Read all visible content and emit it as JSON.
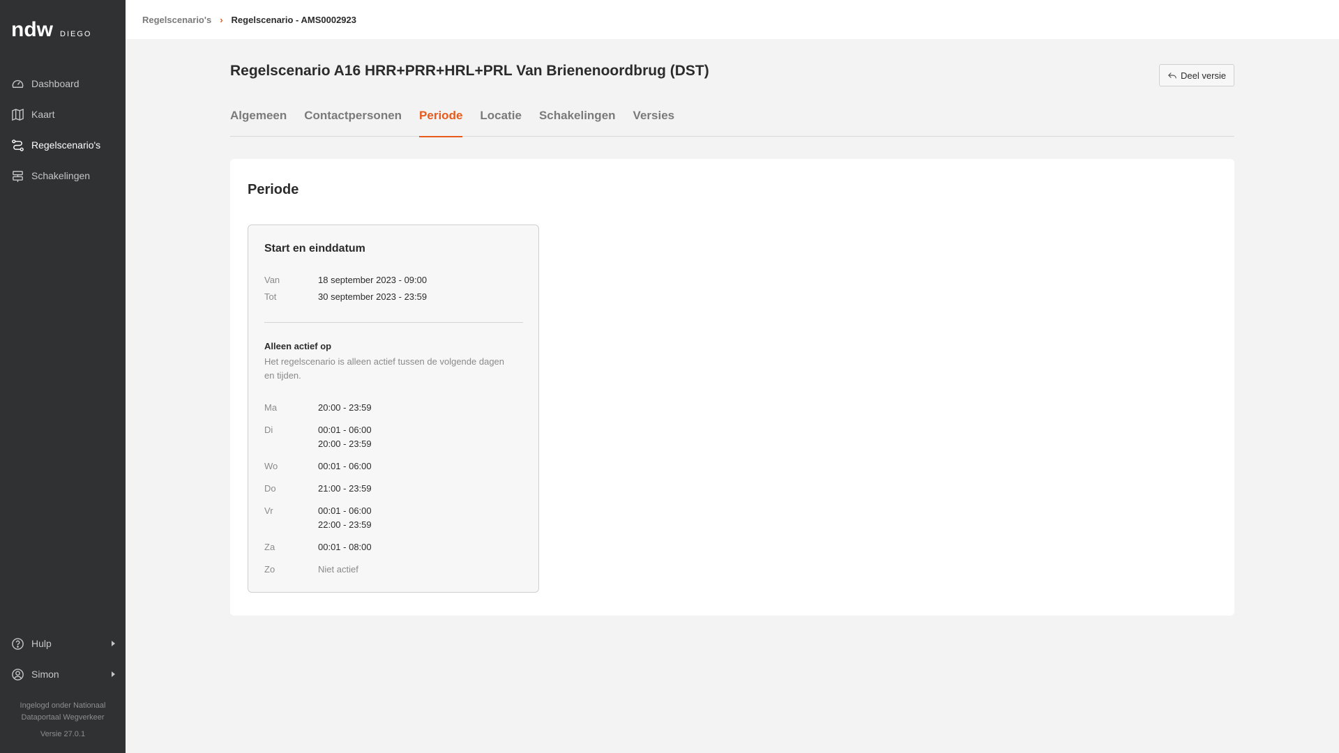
{
  "brand": {
    "logo": "ndw",
    "product": "DIEGO"
  },
  "sidebar": {
    "items": [
      {
        "label": "Dashboard",
        "icon": "gauge-icon"
      },
      {
        "label": "Kaart",
        "icon": "map-icon"
      },
      {
        "label": "Regelscenario's",
        "icon": "route-icon",
        "active": true
      },
      {
        "label": "Schakelingen",
        "icon": "signpost-icon"
      }
    ],
    "bottom": [
      {
        "label": "Hulp",
        "icon": "help-icon"
      },
      {
        "label": "Simon",
        "icon": "user-icon"
      }
    ],
    "footer_line1": "Ingelogd onder Nationaal",
    "footer_line2": "Dataportaal Wegverkeer",
    "version": "Versie 27.0.1"
  },
  "breadcrumb": {
    "parent": "Regelscenario's",
    "current": "Regelscenario - AMS0002923"
  },
  "page": {
    "title": "Regelscenario A16 HRR+PRR+HRL+PRL Van Brienenoordbrug (DST)",
    "share_label": "Deel versie"
  },
  "tabs": [
    "Algemeen",
    "Contactpersonen",
    "Periode",
    "Locatie",
    "Schakelingen",
    "Versies"
  ],
  "active_tab": "Periode",
  "panel": {
    "title": "Periode",
    "card": {
      "title": "Start en einddatum",
      "van_label": "Van",
      "van_value": "18 september 2023 - 09:00",
      "tot_label": "Tot",
      "tot_value": "30 september 2023 - 23:59",
      "active_title": "Alleen actief op",
      "active_desc": "Het regelscenario is alleen actief tussen de volgende dagen en tijden.",
      "days": [
        {
          "day": "Ma",
          "times": [
            "20:00 - 23:59"
          ]
        },
        {
          "day": "Di",
          "times": [
            "00:01 - 06:00",
            "20:00 - 23:59"
          ]
        },
        {
          "day": "Wo",
          "times": [
            "00:01 - 06:00"
          ]
        },
        {
          "day": "Do",
          "times": [
            "21:00 - 23:59"
          ]
        },
        {
          "day": "Vr",
          "times": [
            "00:01 - 06:00",
            "22:00 - 23:59"
          ]
        },
        {
          "day": "Za",
          "times": [
            "00:01 - 08:00"
          ]
        },
        {
          "day": "Zo",
          "times": [
            "Niet actief"
          ]
        }
      ]
    }
  },
  "colors": {
    "accent": "#e85a1c",
    "sidebar": "#2f3133",
    "background": "#f3f3f3"
  }
}
